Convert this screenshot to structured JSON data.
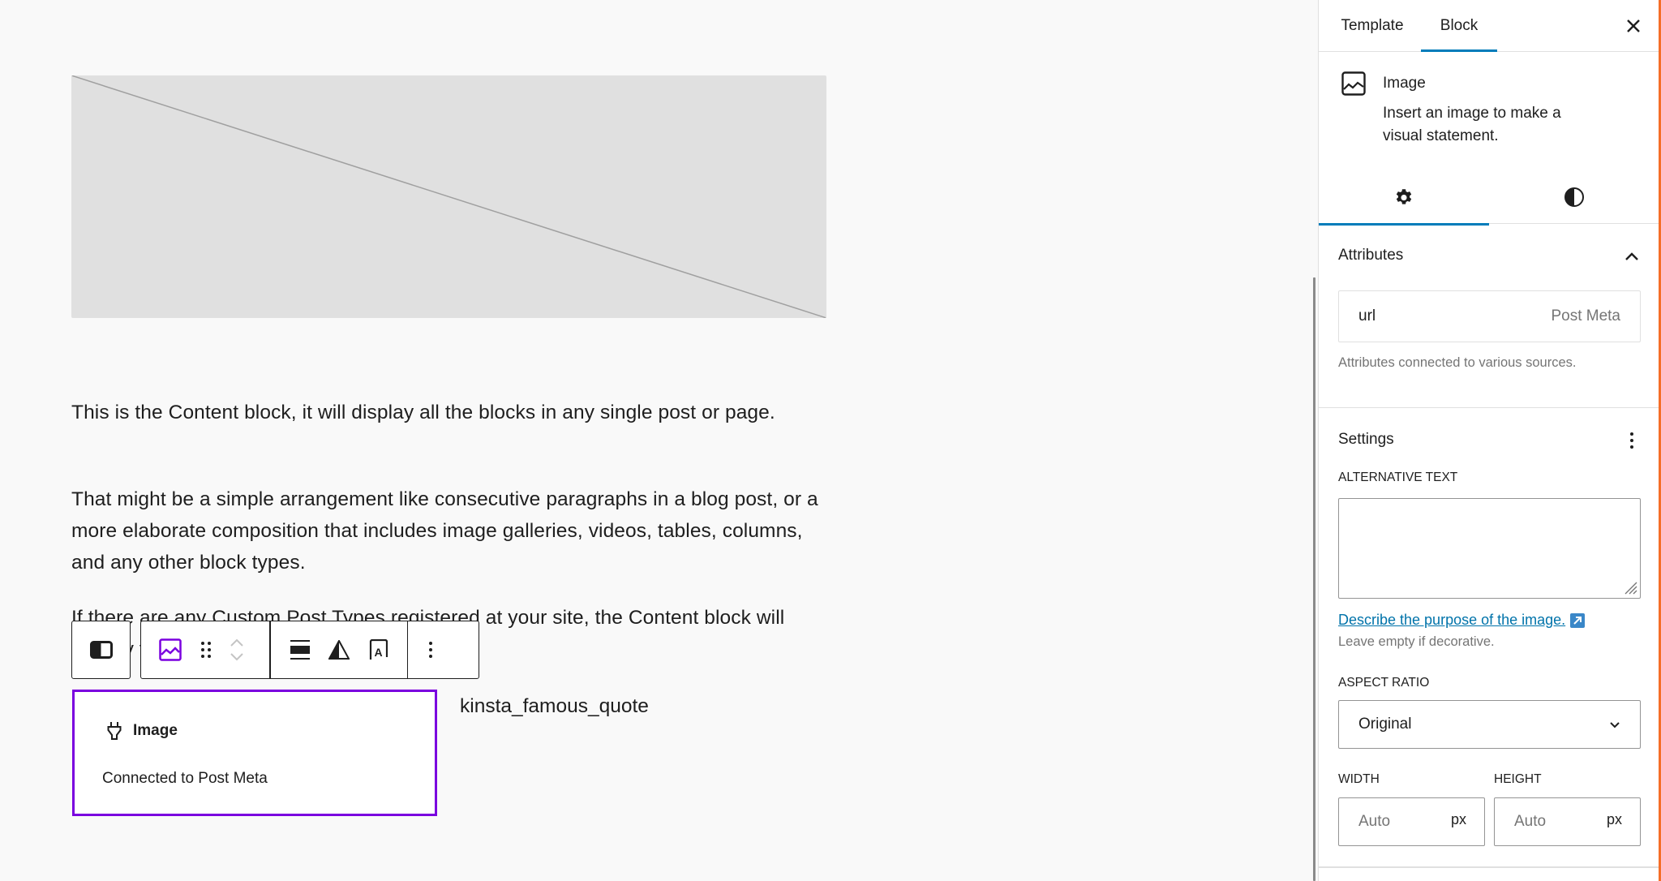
{
  "canvas": {
    "image_placeholder": {
      "label": "Image placeholder"
    },
    "paragraphs": [
      "This is the Content block, it will display all the blocks in any single post or page.",
      "That might be a simple arrangement like consecutive paragraphs in a blog post, or a more elaborate composition that includes image galleries, videos, tables, columns, and any other block types.",
      "If there are any Custom Post Types registered at your site, the Content block will display their contents as well."
    ],
    "block_toolbar": {
      "buttons": [
        {
          "name": "select-parent",
          "icon": "columns-icon"
        },
        {
          "name": "block-type",
          "icon": "image-icon"
        },
        {
          "name": "drag",
          "icon": "drag-handle-icon"
        },
        {
          "name": "move-up",
          "icon": "chevron-up-icon"
        },
        {
          "name": "move-down",
          "icon": "chevron-down-icon"
        },
        {
          "name": "align",
          "icon": "align-wide-icon"
        },
        {
          "name": "duotone",
          "icon": "duotone-filter-icon"
        },
        {
          "name": "caption",
          "icon": "caption-icon"
        },
        {
          "name": "options",
          "icon": "more-vertical-icon"
        }
      ]
    },
    "image_block": {
      "icon": "plug-icon",
      "title": "Image",
      "subtitle": "Connected to Post Meta"
    },
    "meta_key_text": "kinsta_famous_quote"
  },
  "sidebar": {
    "tabs": [
      {
        "label": "Template",
        "active": false
      },
      {
        "label": "Block",
        "active": true
      }
    ],
    "close_icon": "close-icon",
    "block_card": {
      "icon": "image-icon",
      "title": "Image",
      "description": "Insert an image to make a visual statement."
    },
    "inspector_tabs": [
      {
        "name": "settings",
        "icon": "gear-icon",
        "active": true
      },
      {
        "name": "styles",
        "icon": "half-circle-icon",
        "active": false
      }
    ],
    "attributes": {
      "title": "Attributes",
      "expanded": true,
      "items": [
        {
          "key": "url",
          "source": "Post Meta"
        }
      ],
      "help": "Attributes connected to various sources."
    },
    "settings": {
      "title": "Settings",
      "alt_text": {
        "label": "Alternative Text",
        "value": "",
        "link": "Describe the purpose of the image.",
        "hint": "Leave empty if decorative."
      },
      "aspect_ratio": {
        "label": "Aspect Ratio",
        "selected": "Original"
      },
      "width": {
        "label": "Width",
        "placeholder": "Auto",
        "unit": "px"
      },
      "height": {
        "label": "Height",
        "placeholder": "Auto",
        "unit": "px"
      }
    }
  },
  "colors": {
    "accent": "#007cba",
    "selection": "#7a00df",
    "admin_edge": "#f56e28",
    "text": "#1e1e1e",
    "muted": "#757575",
    "link": "#0073aa"
  }
}
